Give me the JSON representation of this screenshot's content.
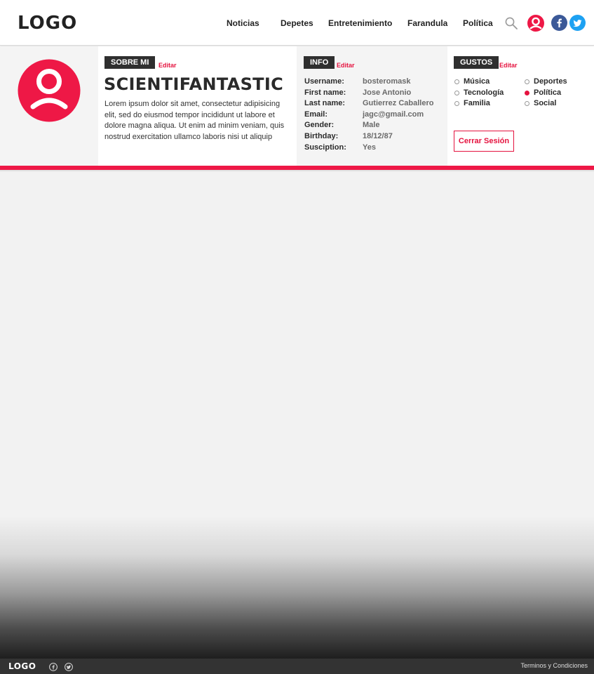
{
  "header": {
    "logo": "LOGO",
    "nav": [
      "Noticias",
      "Depetes",
      "Entretenimiento",
      "Farandula",
      "Política"
    ],
    "icons": [
      "search-icon",
      "user-icon",
      "facebook-icon",
      "twitter-icon"
    ]
  },
  "about": {
    "tag": "SOBRE MI",
    "edit": "Editar",
    "username": "SCIENTIFANTASTIC",
    "bio": "Lorem ipsum dolor sit amet, consectetur adipisicing elit, sed do eiusmod tempor incididunt ut labore et dolore magna aliqua. Ut enim ad minim veniam, quis nostrud exercitation ullamco laboris nisi ut aliquip"
  },
  "info": {
    "tag": "INFO",
    "edit": "Editar",
    "rows": [
      {
        "key": "Username:",
        "value": "bosteromask"
      },
      {
        "key": "First name:",
        "value": "Jose Antonio"
      },
      {
        "key": "Last name:",
        "value": "Gutierrez Caballero"
      },
      {
        "key": "Email:",
        "value": "jagc@gmail.com"
      },
      {
        "key": "Gender:",
        "value": "Male"
      },
      {
        "key": "Birthday:",
        "value": "18/12/87"
      },
      {
        "key": "Susciption:",
        "value": "Yes"
      }
    ]
  },
  "likes": {
    "tag": "GUSTOS",
    "edit": "Editar",
    "items": [
      {
        "label": "Música",
        "selected": false
      },
      {
        "label": "Tecnología",
        "selected": false
      },
      {
        "label": "Familia",
        "selected": false
      },
      {
        "label": "Deportes",
        "selected": false
      },
      {
        "label": "Política",
        "selected": true
      },
      {
        "label": "Social",
        "selected": false
      }
    ],
    "logout": "Cerrar Sesión"
  },
  "footer": {
    "logo": "LOGO",
    "icons": [
      "facebook-icon",
      "twitter-icon"
    ],
    "terms": "Terminos y Condiciones"
  },
  "colors": {
    "accent": "#ee1846",
    "facebook": "#3b5998",
    "twitter": "#1da1f2",
    "footer": "#333333",
    "tag": "#2f2f2f"
  }
}
